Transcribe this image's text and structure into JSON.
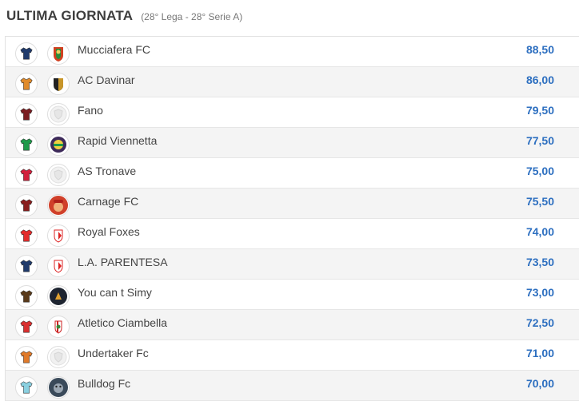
{
  "header": {
    "title": "ULTIMA GIORNATA",
    "subtitle": "(28° Lega - 28° Serie A)"
  },
  "rows": [
    {
      "team": "Mucciafera FC",
      "score": "88,50",
      "shirt_color": "#1f3a6b",
      "logo_icon": "horse-logo-icon"
    },
    {
      "team": "AC Davinar",
      "score": "86,00",
      "shirt_color": "#e08a2a",
      "logo_icon": "black-gold-shield-icon"
    },
    {
      "team": "Fano",
      "score": "79,50",
      "shirt_color": "#7a1c20",
      "logo_icon": "default-shield-icon"
    },
    {
      "team": "Rapid Viennetta",
      "score": "77,50",
      "shirt_color": "#1e9a4a",
      "logo_icon": "green-crest-icon"
    },
    {
      "team": "AS Tronave",
      "score": "75,00",
      "shirt_color": "#d21f3c",
      "logo_icon": "default-shield-icon"
    },
    {
      "team": "Carnage FC",
      "score": "75,50",
      "shirt_color": "#8a1e1e",
      "logo_icon": "mario-logo-icon"
    },
    {
      "team": "Royal Foxes",
      "score": "74,00",
      "shirt_color": "#e32b2b",
      "logo_icon": "red-white-shield-icon"
    },
    {
      "team": "L.A. PARENTESA",
      "score": "73,50",
      "shirt_color": "#1f3a6b",
      "logo_icon": "red-white-shield-icon"
    },
    {
      "team": "You can t Simy",
      "score": "73,00",
      "shirt_color": "#5a3a1a",
      "logo_icon": "dark-round-logo-icon"
    },
    {
      "team": "Atletico Ciambella",
      "score": "72,50",
      "shirt_color": "#d93030",
      "logo_icon": "striped-shield-icon"
    },
    {
      "team": "Undertaker Fc",
      "score": "71,00",
      "shirt_color": "#e07a2a",
      "logo_icon": "default-shield-icon"
    },
    {
      "team": "Bulldog Fc",
      "score": "70,00",
      "shirt_color": "#8ad0e0",
      "logo_icon": "bulldog-logo-icon"
    }
  ],
  "colors": {
    "score": "#2d6fc0",
    "alt_row": "#f4f4f4"
  }
}
